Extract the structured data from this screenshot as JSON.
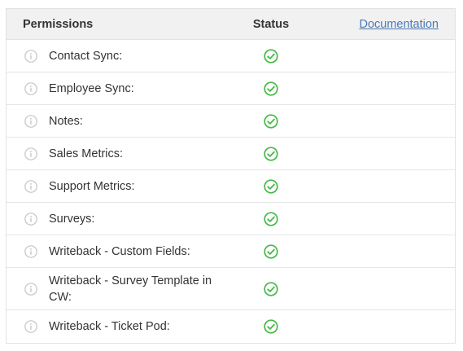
{
  "header": {
    "permissions": "Permissions",
    "status": "Status",
    "documentation": "Documentation"
  },
  "colors": {
    "check": "#46b946",
    "info": "#bdbdbd",
    "link": "#4a7ab5"
  },
  "rows": [
    {
      "label": "Contact Sync:",
      "status_icon": "check-circle-icon"
    },
    {
      "label": "Employee Sync:",
      "status_icon": "check-circle-icon"
    },
    {
      "label": "Notes:",
      "status_icon": "check-circle-icon"
    },
    {
      "label": "Sales Metrics:",
      "status_icon": "check-circle-icon"
    },
    {
      "label": "Support Metrics:",
      "status_icon": "check-circle-icon"
    },
    {
      "label": "Surveys:",
      "status_icon": "check-circle-icon"
    },
    {
      "label": "Writeback - Custom Fields:",
      "status_icon": "check-circle-icon"
    },
    {
      "label": "Writeback - Survey Template in CW:",
      "status_icon": "check-circle-icon"
    },
    {
      "label": "Writeback - Ticket Pod:",
      "status_icon": "check-circle-icon"
    }
  ]
}
